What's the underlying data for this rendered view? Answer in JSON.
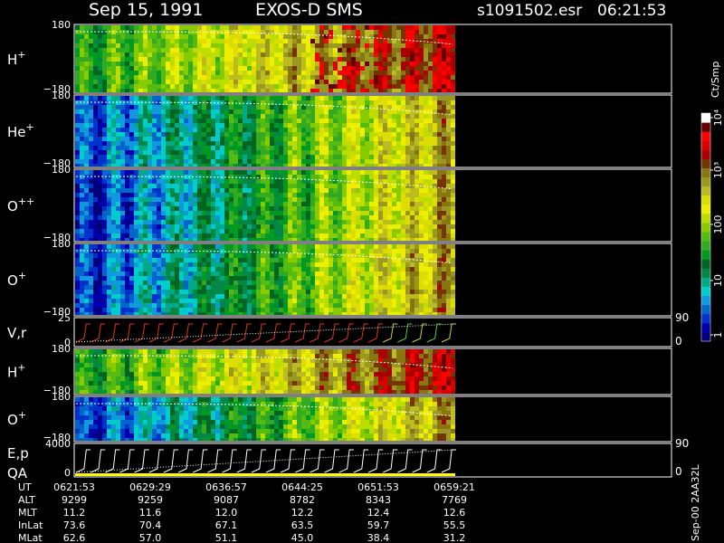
{
  "header": {
    "date": "Sep 15, 1991",
    "instrument": "EXOS-D SMS",
    "file": "s1091502.esr",
    "time": "06:21:53"
  },
  "colorbar": {
    "unit": "Ct/Smp",
    "tick_labels": [
      "1",
      "10",
      "100",
      "10³",
      "10⁴"
    ],
    "colors": [
      "#00007a",
      "#0000aa",
      "#0033cc",
      "#0066cc",
      "#1199dd",
      "#00cccc",
      "#00aa88",
      "#008844",
      "#006622",
      "#009922",
      "#33aa22",
      "#55bb11",
      "#88cc00",
      "#bbdd00",
      "#eeee00",
      "#dddd00",
      "#bbbb22",
      "#999922",
      "#887711",
      "#773300",
      "#aa0000",
      "#dd0000",
      "#ff0000",
      "#660000",
      "#ffffff"
    ]
  },
  "side_label": "Sep-00  2AA32L",
  "chart_data": [
    {
      "type": "heatmap",
      "name": "H+ pitch angle",
      "label_main": "H",
      "label_sup": "+",
      "yticks": [
        "180",
        "−180"
      ],
      "ylim": [
        -180,
        180
      ]
    },
    {
      "type": "heatmap",
      "name": "He+ pitch angle",
      "label_main": "He",
      "label_sup": "+",
      "yticks": [
        "180",
        "−180"
      ],
      "ylim": [
        -180,
        180
      ]
    },
    {
      "type": "heatmap",
      "name": "O++ pitch angle",
      "label_main": "O",
      "label_sup": "++",
      "yticks": [
        "180",
        "−180"
      ],
      "ylim": [
        -180,
        180
      ]
    },
    {
      "type": "heatmap",
      "name": "O+ pitch angle",
      "label_main": "O",
      "label_sup": "+",
      "yticks": [
        "180",
        "−180"
      ],
      "ylim": [
        -180,
        180
      ]
    },
    {
      "type": "line",
      "name": "V,r",
      "label_main": "V,r",
      "label_sup": "",
      "yticks": [
        "25",
        "0"
      ],
      "right_ticks": [
        "90",
        "0"
      ],
      "ylim": [
        0,
        25
      ]
    },
    {
      "type": "heatmap",
      "name": "H+ energy",
      "label_main": "H",
      "label_sup": "+",
      "yticks": [
        "180",
        "−180"
      ],
      "ylim": [
        -180,
        180
      ]
    },
    {
      "type": "heatmap",
      "name": "O+ energy",
      "label_main": "O",
      "label_sup": "+",
      "yticks": [
        "180",
        "−180"
      ],
      "ylim": [
        -180,
        180
      ]
    },
    {
      "type": "line",
      "name": "E,p QA",
      "label_main": "E,p",
      "label_sub": "QA",
      "label_sup": "",
      "yticks": [
        "4000",
        "0"
      ],
      "right_ticks": [
        "90",
        "0"
      ],
      "ylim": [
        0,
        4000
      ]
    }
  ],
  "ephemeris": {
    "row_labels": [
      "UT",
      "ALT",
      "MLT",
      "InLat",
      "MLat"
    ],
    "columns": [
      [
        "0621:53",
        "9299",
        "11.2",
        "73.6",
        "62.6"
      ],
      [
        "0629:29",
        "9259",
        "11.6",
        "70.4",
        "57.0"
      ],
      [
        "0636:57",
        "9087",
        "12.0",
        "67.1",
        "51.1"
      ],
      [
        "0644:25",
        "8782",
        "12.2",
        "63.5",
        "45.0"
      ],
      [
        "0651:53",
        "8343",
        "12.4",
        "59.7",
        "38.4"
      ],
      [
        "0659:21",
        "7769",
        "12.6",
        "55.5",
        "31.2"
      ]
    ]
  }
}
